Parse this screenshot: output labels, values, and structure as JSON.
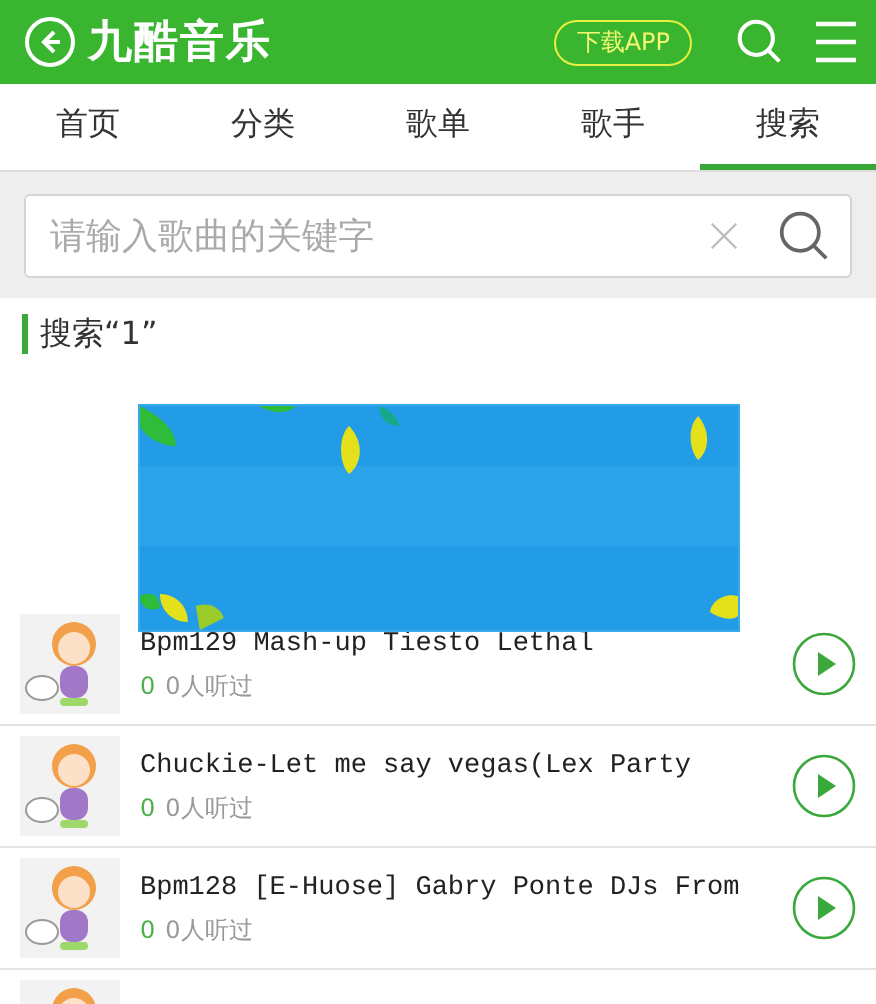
{
  "header": {
    "title": "九酷音乐",
    "download_button": "下载APP"
  },
  "tabs": [
    {
      "label": "首页",
      "selected": false
    },
    {
      "label": "分类",
      "selected": false
    },
    {
      "label": "歌单",
      "selected": false
    },
    {
      "label": "歌手",
      "selected": false
    },
    {
      "label": "搜索",
      "selected": true
    }
  ],
  "search": {
    "placeholder": "请输入歌曲的关键字"
  },
  "results_heading": "搜索“1”",
  "songs": [
    {
      "title": "Bpm129 Mash-up Tiesto Lethal",
      "count": "0",
      "listens": "0人听过"
    },
    {
      "title": "Chuckie-Let me say vegas(Lex Party",
      "count": "0",
      "listens": "0人听过"
    },
    {
      "title": "Bpm128 [E-Huose] Gabry Ponte DJs From",
      "count": "0",
      "listens": "0人听过"
    }
  ]
}
